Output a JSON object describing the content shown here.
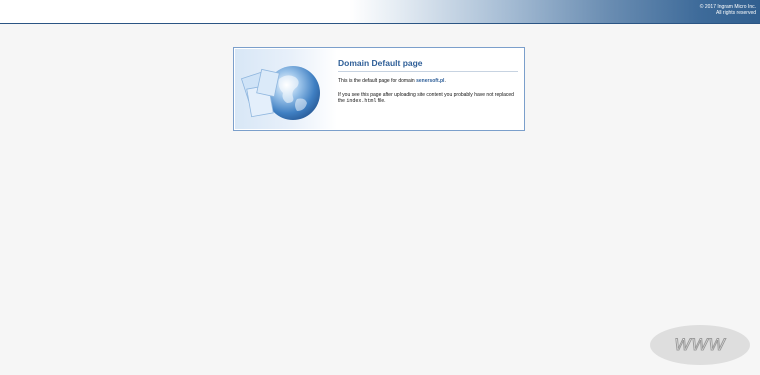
{
  "banner": {
    "copyright_line1": "© 2017 Ingram Micro Inc.",
    "copyright_line2": "All rights reserved"
  },
  "card": {
    "title": "Domain Default page",
    "line1_prefix": "This is the default page for domain ",
    "domain": "senersoft.pl",
    "line1_suffix": ".",
    "line2_prefix": "If you see this page after uploading site content you probably have not replaced the ",
    "file_name": "index.html",
    "line2_suffix": " file.",
    "illustration_icon": "globe-with-documents-icon"
  },
  "badge": {
    "text": "WWW"
  },
  "colors": {
    "accent": "#2f5f98",
    "banner_dark": "#315f8f",
    "background": "#f6f6f6"
  }
}
